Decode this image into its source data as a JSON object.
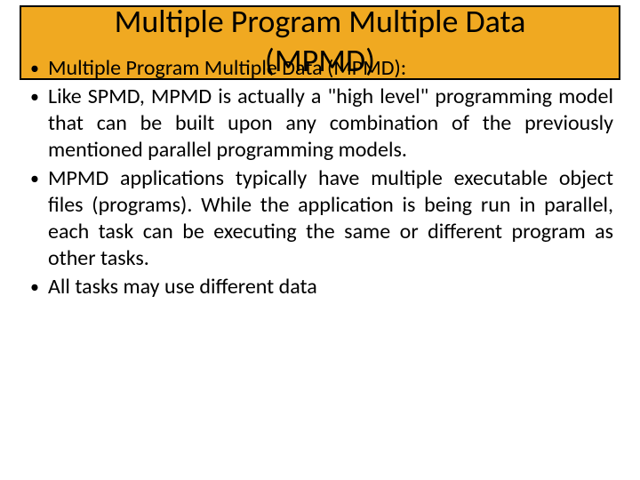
{
  "title": {
    "line1": "Multiple Program Multiple Data",
    "line2": "(MPMD)"
  },
  "bullets": [
    "Multiple Program Multiple Data (MPMD):",
    "Like SPMD, MPMD is actually a \"high level\" programming model that can be built upon any combination of the previously mentioned parallel programming models.",
    "MPMD applications typically have multiple executable object files (programs). While the application is being run in parallel, each task can be executing the same or different program as other tasks.",
    "All tasks may use different data"
  ]
}
